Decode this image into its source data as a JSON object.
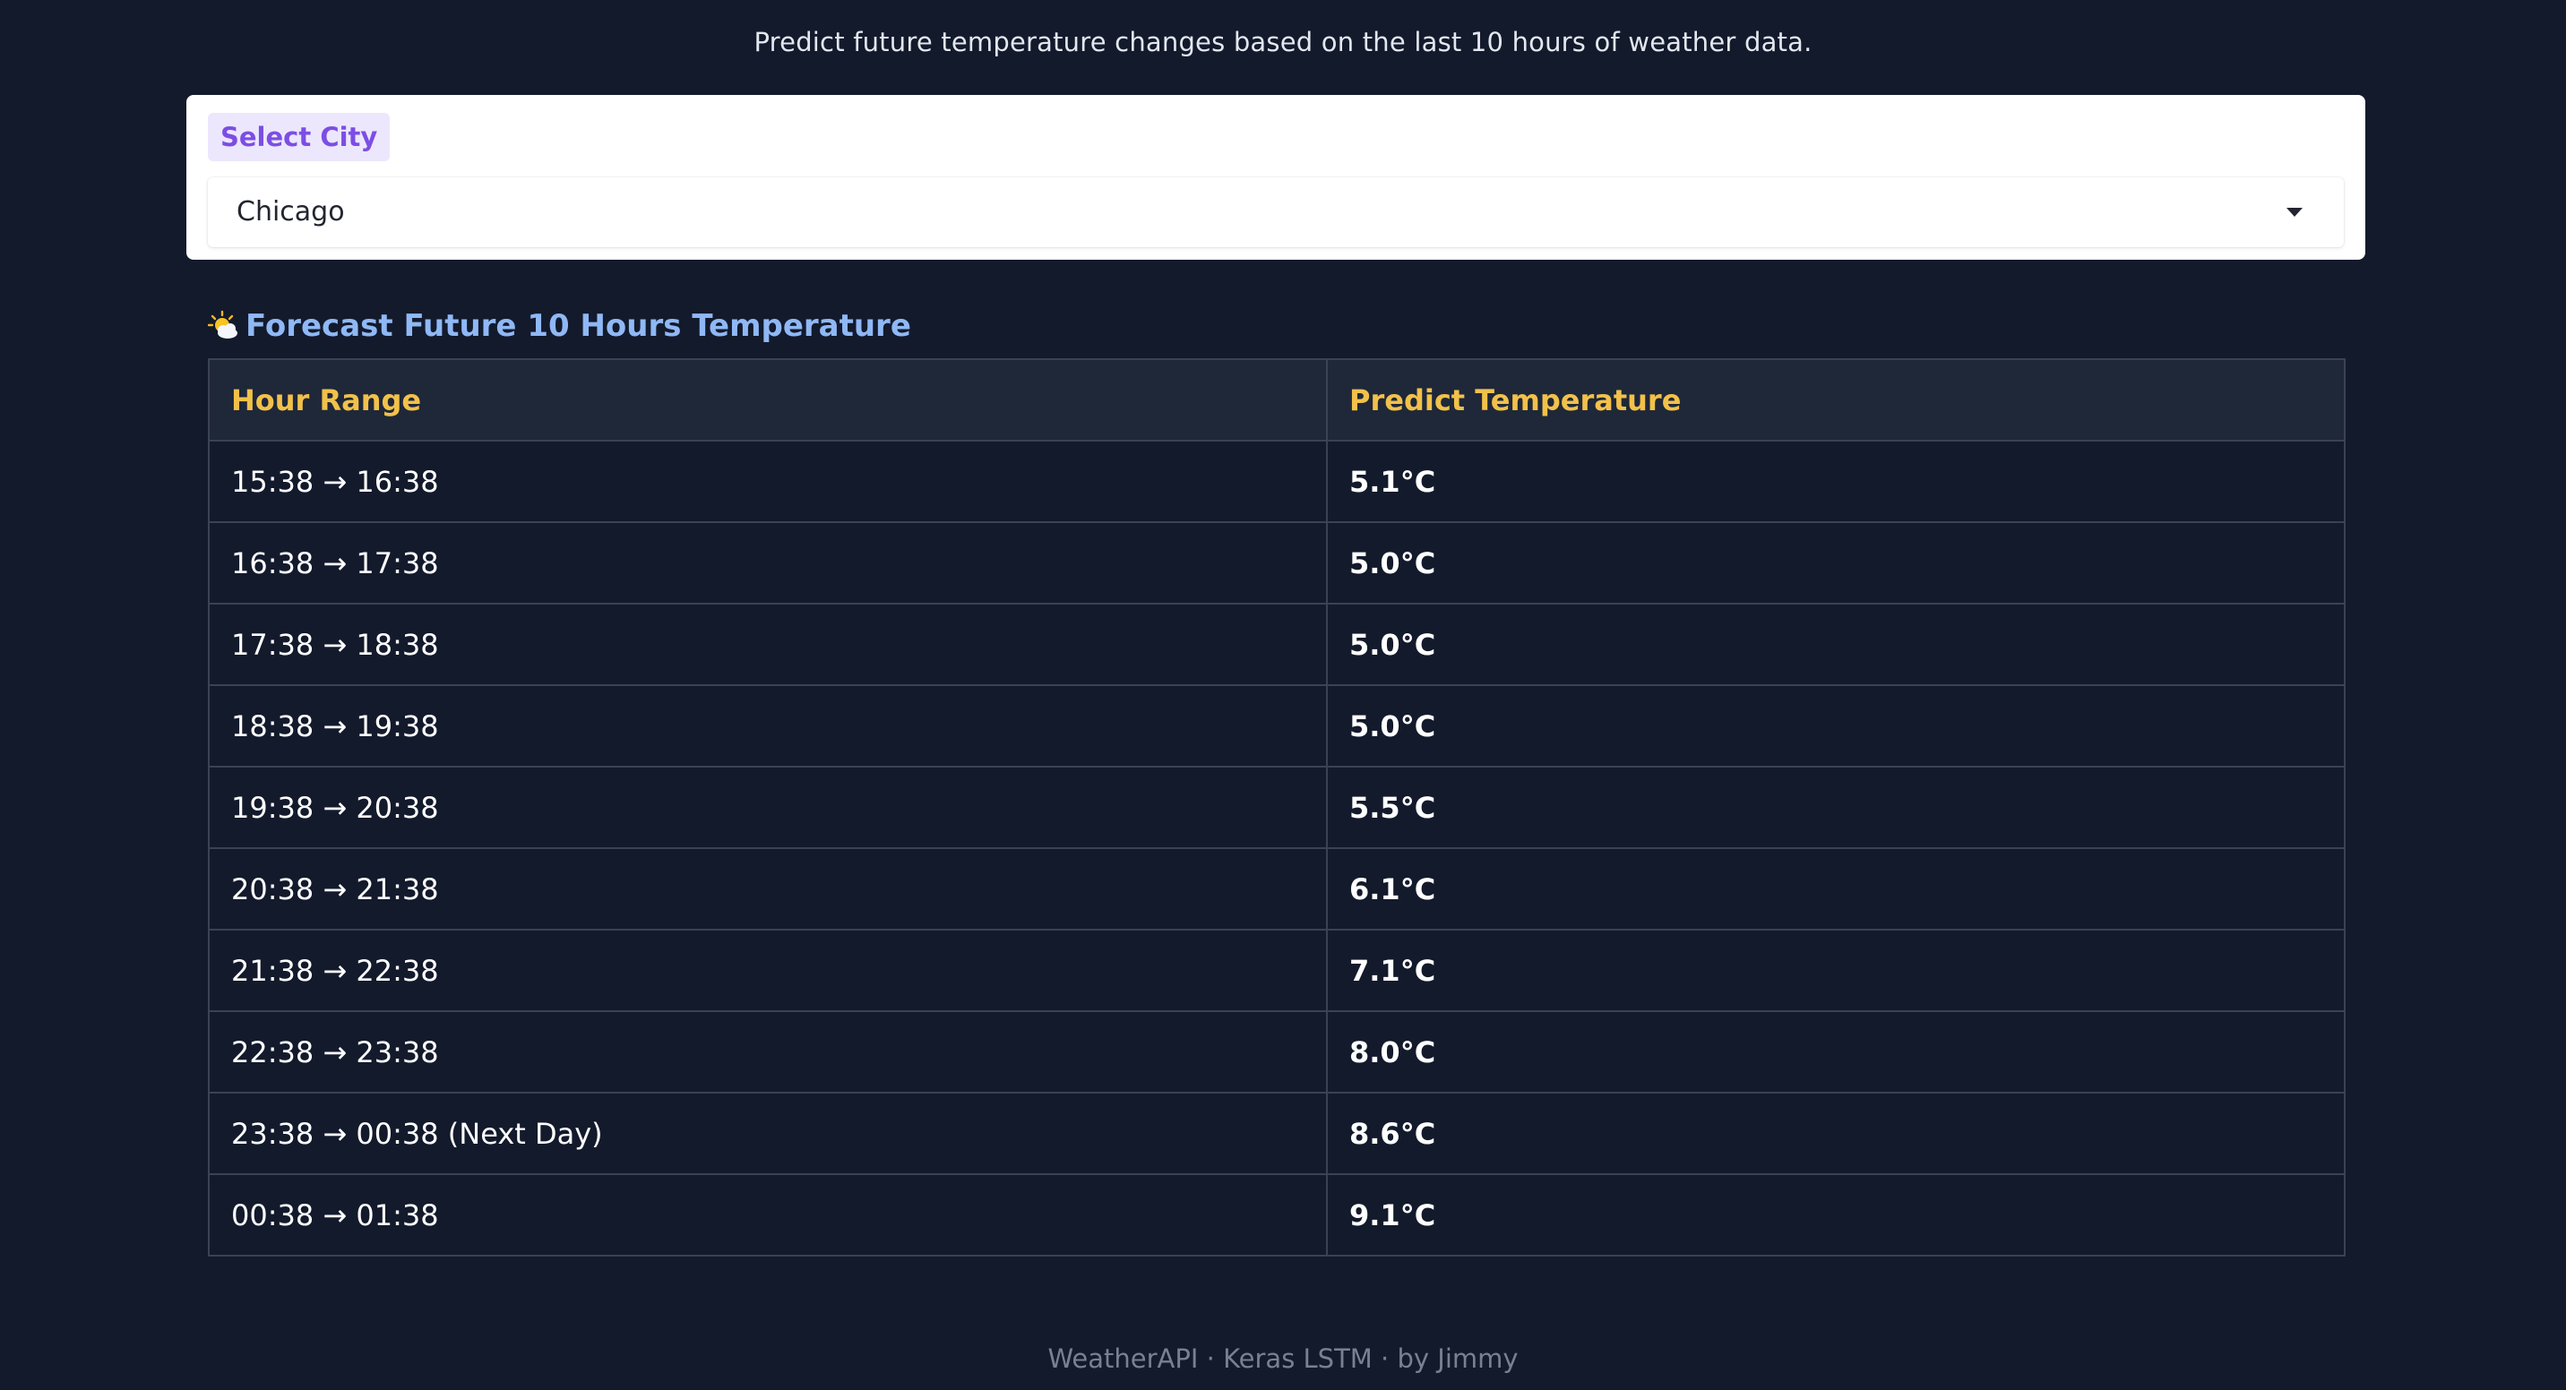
{
  "header": {
    "subtitle": "Predict future temperature changes based on the last 10 hours of weather data."
  },
  "city_selector": {
    "label": "Select City",
    "selected": "Chicago"
  },
  "forecast": {
    "icon": "sun-behind-cloud-icon",
    "title": "Forecast Future 10 Hours Temperature",
    "columns": [
      "Hour Range",
      "Predict Temperature"
    ],
    "rows": [
      {
        "range": "15:38 → 16:38",
        "temp": "5.1°C"
      },
      {
        "range": "16:38 → 17:38",
        "temp": "5.0°C"
      },
      {
        "range": "17:38 → 18:38",
        "temp": "5.0°C"
      },
      {
        "range": "18:38 → 19:38",
        "temp": "5.0°C"
      },
      {
        "range": "19:38 → 20:38",
        "temp": "5.5°C"
      },
      {
        "range": "20:38 → 21:38",
        "temp": "6.1°C"
      },
      {
        "range": "21:38 → 22:38",
        "temp": "7.1°C"
      },
      {
        "range": "22:38 → 23:38",
        "temp": "8.0°C"
      },
      {
        "range": "23:38 → 00:38 (Next Day)",
        "temp": "8.6°C"
      },
      {
        "range": "00:38 → 01:38",
        "temp": "9.1°C"
      }
    ]
  },
  "footer": {
    "text": "WeatherAPI · Keras LSTM · by Jimmy"
  },
  "colors": {
    "background": "#131a2c",
    "header_row": "#1f2839",
    "header_text": "#f2c14a",
    "title_text": "#8fb8f5",
    "label_accent": "#7c4ee4"
  }
}
